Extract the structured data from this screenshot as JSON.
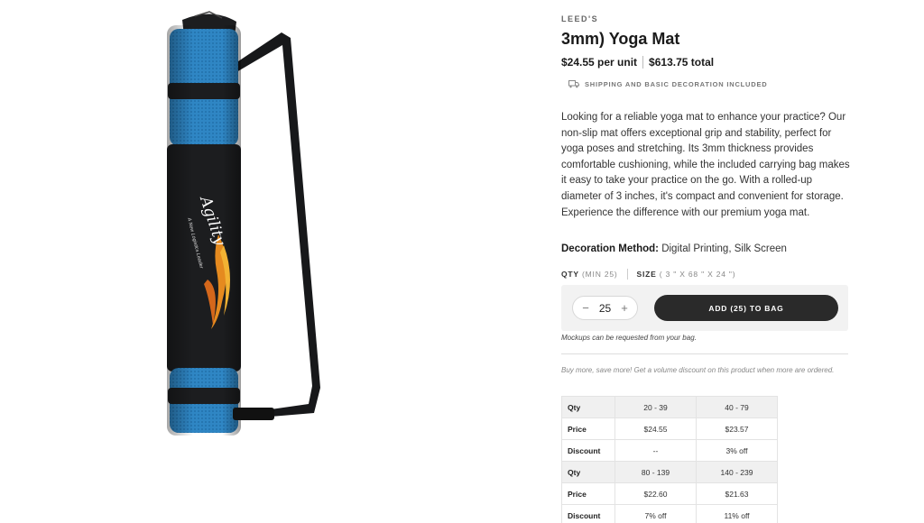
{
  "product": {
    "brand": "LEED'S",
    "title": "3mm) Yoga Mat",
    "unit_price": "$24.55 per unit",
    "total_price": "$613.75 total",
    "shipping_note": "SHIPPING AND BASIC DECORATION INCLUDED",
    "description": "Looking for a reliable yoga mat to enhance your practice? Our non-slip mat offers exceptional grip and stability, perfect for yoga poses and stretching. Its 3mm thickness provides comfortable cushioning, while the included carrying bag makes it easy to take your practice on the go. With a rolled-up diameter of 3 inches, it's compact and convenient for storage. Experience the difference with our premium yoga mat.",
    "decoration_label": "Decoration Method:",
    "decoration_value": "Digital Printing, Silk Screen",
    "image_text": {
      "brand": "Agility",
      "tagline": "A New Logistics Leader"
    }
  },
  "options": {
    "qty_label": "QTY",
    "qty_min": "(MIN 25)",
    "size_label": "SIZE",
    "size_value": "( 3 \" X 68 \" X 24 \")"
  },
  "cart": {
    "minus": "−",
    "plus": "+",
    "quantity": "25",
    "add_button": "ADD (25) TO BAG",
    "mockups_note": "Mockups can be requested from your bag."
  },
  "volume": {
    "note": "Buy more, save more! Get a volume discount on this product when more are ordered.",
    "rows": [
      {
        "label": "Qty",
        "values": [
          "20 - 39",
          "40 - 79"
        ],
        "head": true
      },
      {
        "label": "Price",
        "values": [
          "$24.55",
          "$23.57"
        ],
        "head": false
      },
      {
        "label": "Discount",
        "values": [
          "--",
          "3% off"
        ],
        "head": false
      },
      {
        "label": "Qty",
        "values": [
          "80 - 139",
          "140 - 239"
        ],
        "head": true
      },
      {
        "label": "Price",
        "values": [
          "$22.60",
          "$21.63"
        ],
        "head": false
      },
      {
        "label": "Discount",
        "values": [
          "7% off",
          "11% off"
        ],
        "head": false
      }
    ]
  },
  "colors": {
    "bag_black": "#1c1d1f",
    "mesh_blue": "#2f86c4",
    "button_dark": "#2a2a2a"
  }
}
